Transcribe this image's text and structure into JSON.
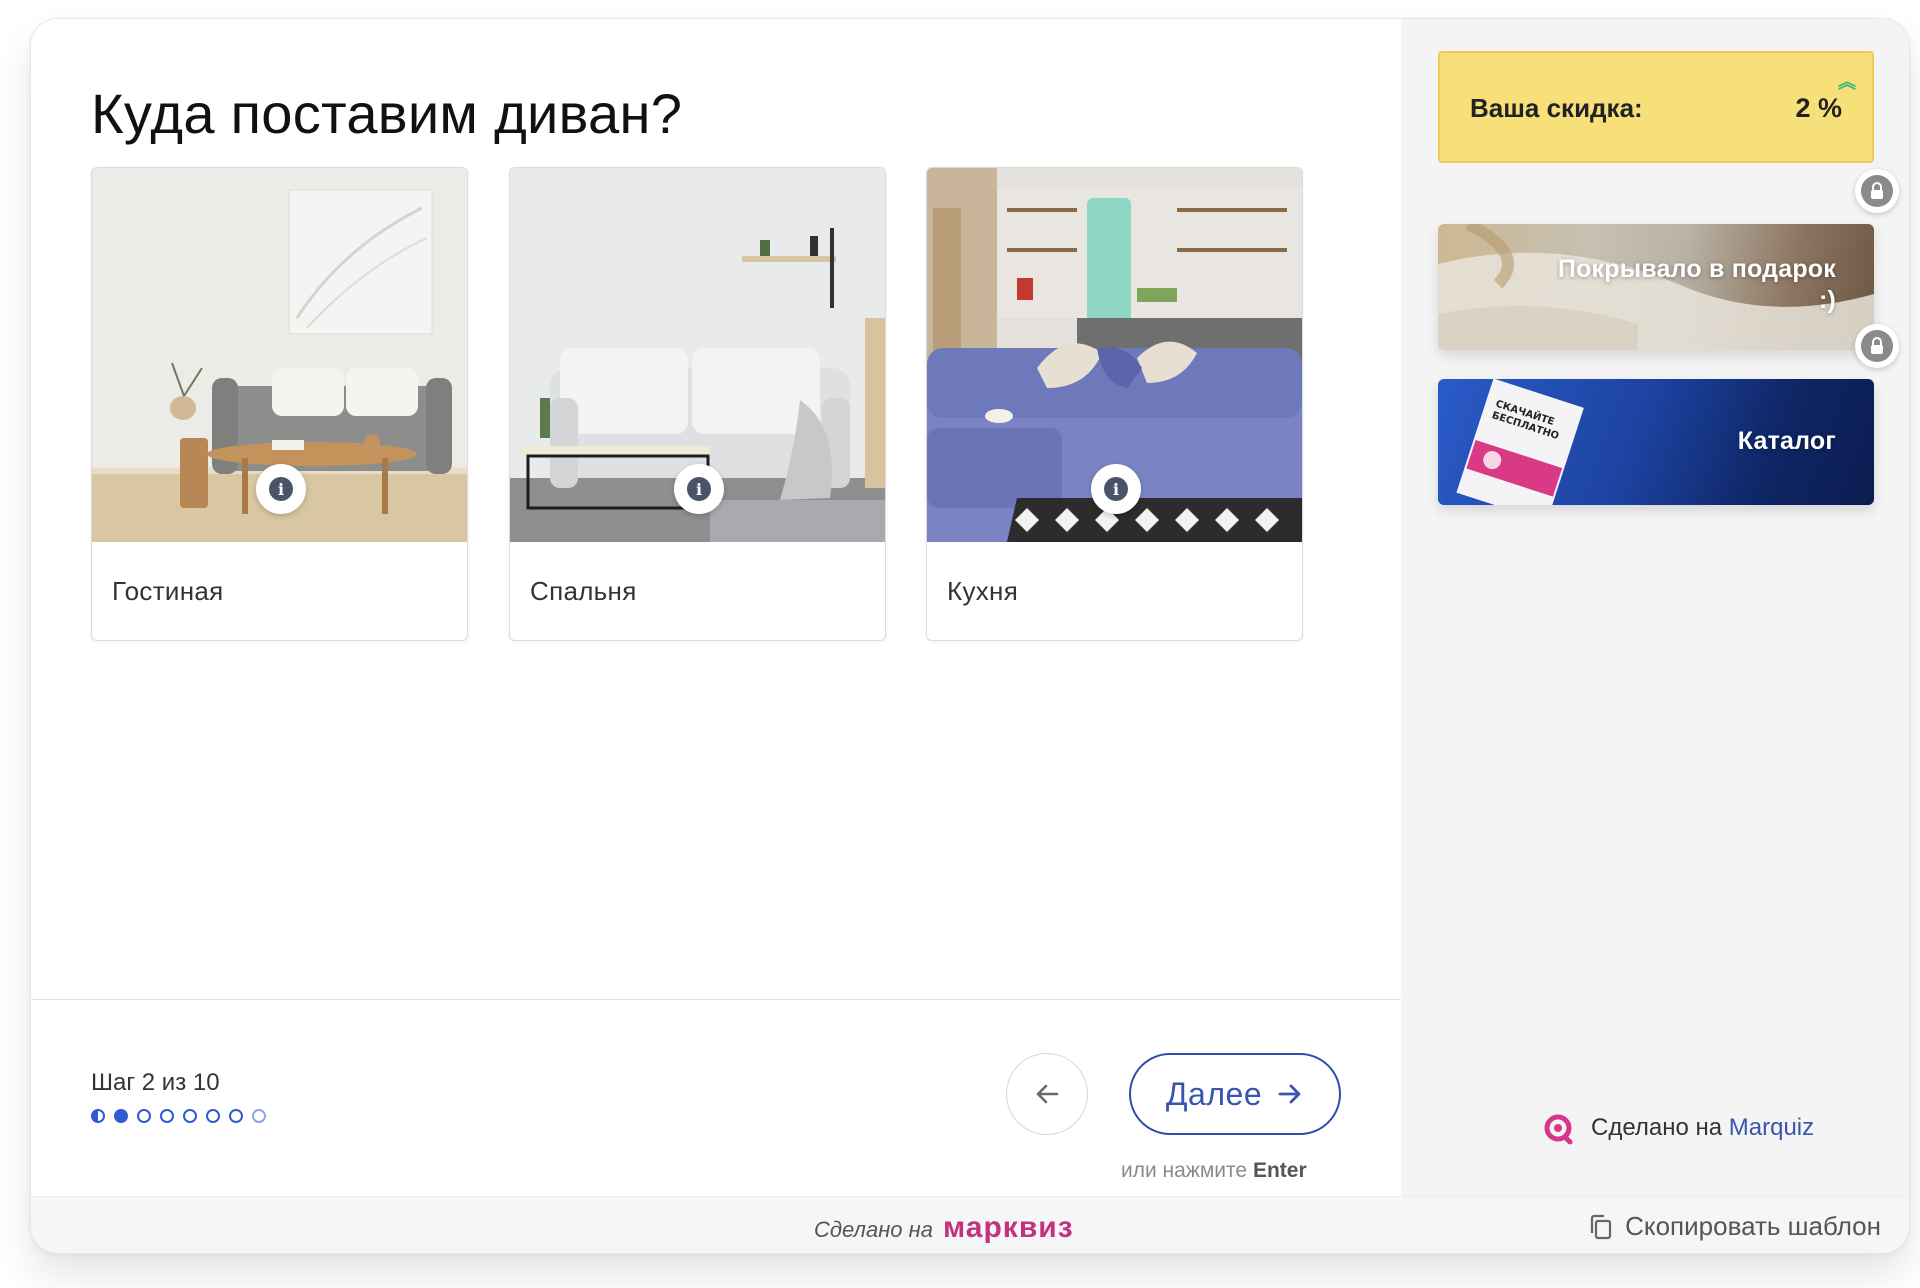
{
  "question": {
    "title": "Куда поставим диван?"
  },
  "options": [
    {
      "label": "Гостиная",
      "image": "living-room-photo"
    },
    {
      "label": "Спальня",
      "image": "bedroom-photo"
    },
    {
      "label": "Кухня",
      "image": "kitchen-photo"
    }
  ],
  "icons": {
    "info": "info-icon",
    "lock": "lock-icon",
    "back": "arrow-left-icon",
    "next": "arrow-right-icon",
    "copy": "copy-icon",
    "discount_up": "double-chevron-up-icon"
  },
  "footer": {
    "step_text": "Шаг 2 из 10",
    "next_label": "Далее",
    "hint_prefix": "или нажмите",
    "hint_key": "Enter"
  },
  "sidebar": {
    "discount_label": "Ваша скидка:",
    "discount_value": "2 %",
    "bonuses": [
      {
        "label_line1": "Покрывало в подарок",
        "label_line2": ":)"
      },
      {
        "label_line1": "Каталог",
        "catalog_cover_line1": "СКАЧАЙТЕ",
        "catalog_cover_line2": "БЕСПЛАТНО"
      }
    ],
    "made_on_prefix": "Сделано на",
    "made_on_brand": "Marquiz"
  },
  "bottom_bar": {
    "made_on_prefix": "Сделано на",
    "made_on_logo": "марквиз",
    "copy_label": "Скопировать шаблон"
  },
  "colors": {
    "accent": "#2f5bd3",
    "discount_bg": "#f7df7a",
    "brand_pink": "#c4327e",
    "link_blue": "#3a55b0"
  }
}
